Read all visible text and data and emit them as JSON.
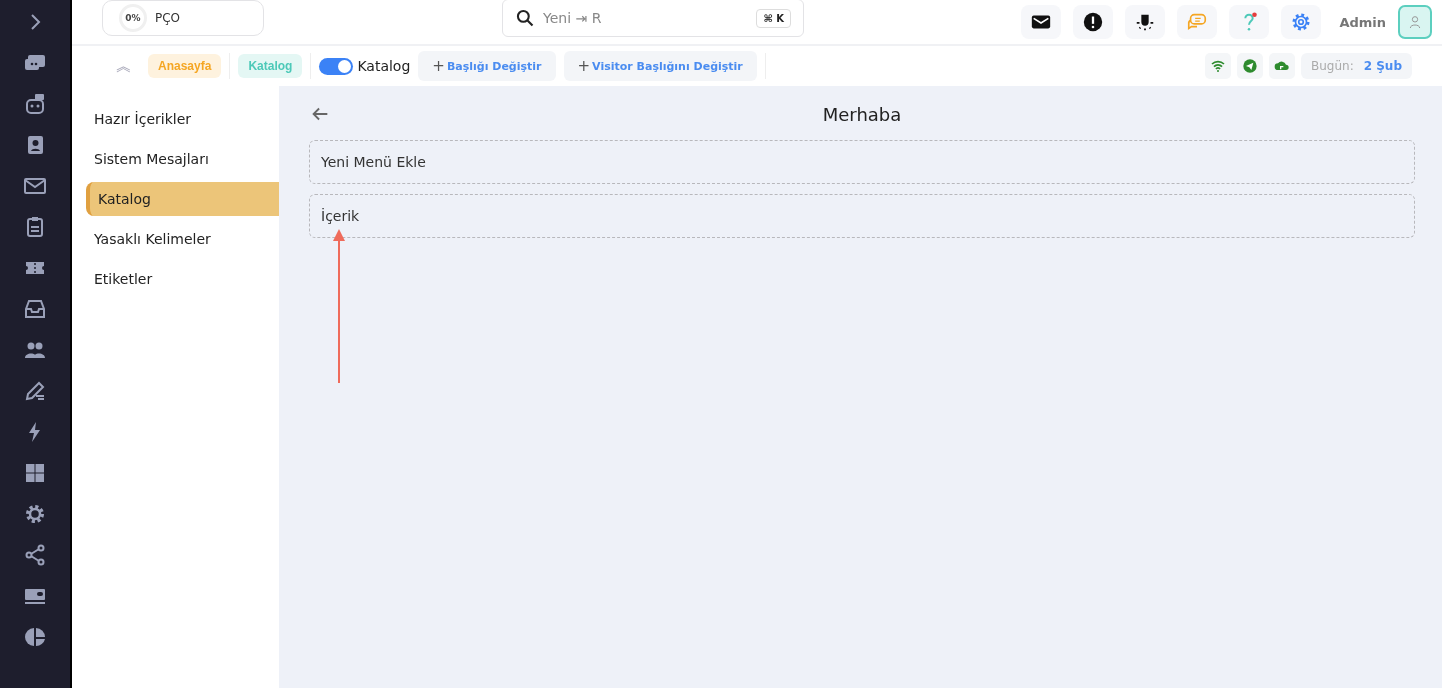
{
  "progress": {
    "reading": "0%",
    "label": "PÇO",
    "level": 0
  },
  "search": {
    "value": "Yeni ⇥ R",
    "shortcut": "⌘ K"
  },
  "user": {
    "name": "Admin"
  },
  "toolbar": {
    "expand_icon": "︽",
    "breadcrumbs": [
      {
        "label": "Anasayfa",
        "color": "#f5a623"
      },
      {
        "label": "Katalog",
        "color": "#4cc9b8"
      }
    ],
    "toggle": {
      "on": true,
      "label": "Katalog"
    },
    "actions": [
      {
        "plus": "+",
        "label": "Başlığı Değiştir"
      },
      {
        "plus": "+",
        "label": "Visitor Başlığını Değiştir"
      }
    ],
    "date": {
      "label": "Bugün:",
      "value": "2 Şub"
    }
  },
  "menu": [
    {
      "label": "Hazır İçerikler",
      "selected": false
    },
    {
      "label": "Sistem Mesajları",
      "selected": false
    },
    {
      "label": "Katalog",
      "selected": true
    },
    {
      "label": "Yasaklı Kelimeler",
      "selected": false
    },
    {
      "label": "Etiketler",
      "selected": false
    }
  ],
  "content": {
    "title": "Merhaba",
    "rows": [
      "Yeni Menü Ekle",
      "İçerik"
    ]
  }
}
